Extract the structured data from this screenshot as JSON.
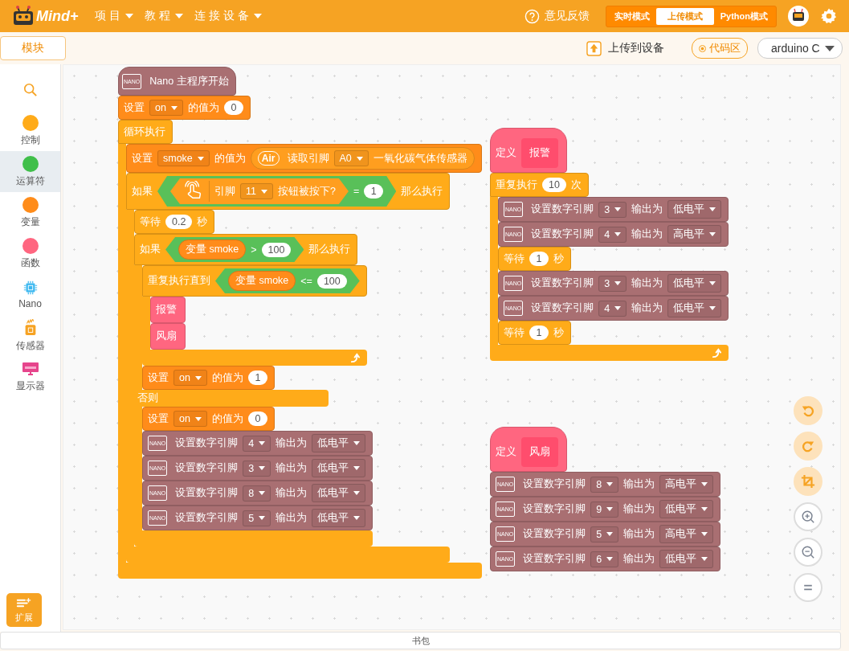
{
  "top_bar": {
    "logo": "Mind+",
    "menus": [
      {
        "label": "项目"
      },
      {
        "label": "教程"
      },
      {
        "label": "连接设备"
      }
    ],
    "feedback": "意见反馈",
    "modes": [
      {
        "label": "实时模式",
        "selected": false
      },
      {
        "label": "上传模式",
        "selected": true
      },
      {
        "label": "Python模式",
        "selected": false
      }
    ]
  },
  "toolbar": {
    "tab": "模块",
    "upload": "上传到设备",
    "code_area": "代码区",
    "device": "arduino C"
  },
  "sidebar": {
    "categories": [
      {
        "kind": "search",
        "selected": false
      },
      {
        "kind": "dot",
        "label": "控制",
        "color": "#ffab19",
        "selected": false
      },
      {
        "kind": "dot",
        "label": "运算符",
        "color": "#40bf4a",
        "selected": true
      },
      {
        "kind": "dot",
        "label": "变量",
        "color": "#ff8c1a",
        "selected": false
      },
      {
        "kind": "dot",
        "label": "函数",
        "color": "#ff6680",
        "selected": false
      },
      {
        "kind": "chip",
        "label": "Nano",
        "selected": false
      },
      {
        "kind": "sensor",
        "label": "传感器",
        "selected": false
      },
      {
        "kind": "display",
        "label": "显示器",
        "selected": false
      }
    ],
    "extension": "扩展"
  },
  "scripts": [
    {
      "blocks": [
        {
          "kind": "hat",
          "color": "#a96f72",
          "parts": [
            {
              "kind": "board",
              "text": "NANO"
            },
            {
              "kind": "text",
              "text": "Nano 主程序开始"
            }
          ]
        },
        {
          "kind": "stack",
          "color": "#ff8c1a",
          "parts": [
            {
              "kind": "text",
              "text": "设置"
            },
            {
              "kind": "dropdown",
              "text": "on"
            },
            {
              "kind": "text",
              "text": "的值为"
            },
            {
              "kind": "number",
              "text": "0"
            }
          ]
        },
        {
          "kind": "forever",
          "color": "#ffab19",
          "parts": [
            {
              "kind": "text",
              "text": "循环执行"
            }
          ],
          "body": [
            {
              "kind": "stack",
              "color": "#ff8c1a",
              "parts": [
                {
                  "kind": "text",
                  "text": "设置"
                },
                {
                  "kind": "dropdown",
                  "text": "smoke"
                },
                {
                  "kind": "text",
                  "text": "的值为"
                },
                {
                  "kind": "reporter",
                  "color": "#ff9e1f",
                  "parts": [
                    {
                      "kind": "cloud",
                      "text": "Air"
                    },
                    {
                      "kind": "text",
                      "text": "读取引脚"
                    },
                    {
                      "kind": "dropdown",
                      "text": "A0"
                    },
                    {
                      "kind": "text",
                      "text": "一氧化碳气体传感器"
                    }
                  ]
                }
              ]
            },
            {
              "kind": "if",
              "color": "#ffab19",
              "parts": [
                {
                  "kind": "text",
                  "text": "如果"
                },
                {
                  "kind": "boolean",
                  "color": "#59c059",
                  "parts": [
                    {
                      "kind": "button-boolean",
                      "color": "#ff9e1f",
                      "parts": [
                        {
                          "kind": "text",
                          "text": "引脚"
                        },
                        {
                          "kind": "dropdown",
                          "text": "11"
                        },
                        {
                          "kind": "text",
                          "text": "按钮被按下?"
                        }
                      ]
                    },
                    {
                      "kind": "text",
                      "text": "="
                    },
                    {
                      "kind": "number",
                      "text": "1"
                    }
                  ]
                },
                {
                  "kind": "text",
                  "text": "那么执行"
                }
              ],
              "body": [
                {
                  "kind": "stack",
                  "color": "#ffab19",
                  "parts": [
                    {
                      "kind": "text",
                      "text": "等待"
                    },
                    {
                      "kind": "number",
                      "text": "0.2"
                    },
                    {
                      "kind": "text",
                      "text": "秒"
                    }
                  ]
                },
                {
                  "kind": "if-else",
                  "color": "#ffab19",
                  "parts": [
                    {
                      "kind": "text",
                      "text": "如果"
                    },
                    {
                      "kind": "boolean",
                      "color": "#59c059",
                      "parts": [
                        {
                          "kind": "reporter",
                          "color": "#ff8c1a",
                          "parts": [
                            {
                              "kind": "text",
                              "text": "变量 smoke"
                            }
                          ]
                        },
                        {
                          "kind": "text",
                          "text": ">"
                        },
                        {
                          "kind": "number",
                          "text": "100"
                        }
                      ]
                    },
                    {
                      "kind": "text",
                      "text": "那么执行"
                    }
                  ],
                  "body": [
                    {
                      "kind": "repeat",
                      "color": "#ffab19",
                      "parts": [
                        {
                          "kind": "text",
                          "text": "重复执行直到"
                        },
                        {
                          "kind": "boolean",
                          "color": "#59c059",
                          "parts": [
                            {
                              "kind": "reporter",
                              "color": "#ff8c1a",
                              "parts": [
                                {
                                  "kind": "text",
                                  "text": "变量 smoke"
                                }
                              ]
                            },
                            {
                              "kind": "text",
                              "text": "<="
                            },
                            {
                              "kind": "number",
                              "text": "100"
                            }
                          ]
                        }
                      ],
                      "body": [
                        {
                          "kind": "call",
                          "color": "#ff6680",
                          "parts": [
                            {
                              "kind": "text",
                              "text": "报警"
                            }
                          ]
                        },
                        {
                          "kind": "call",
                          "color": "#ff6680",
                          "parts": [
                            {
                              "kind": "text",
                              "text": "风扇"
                            }
                          ]
                        }
                      ]
                    },
                    {
                      "kind": "stack",
                      "color": "#ff8c1a",
                      "parts": [
                        {
                          "kind": "text",
                          "text": "设置"
                        },
                        {
                          "kind": "dropdown",
                          "text": "on"
                        },
                        {
                          "kind": "text",
                          "text": "的值为"
                        },
                        {
                          "kind": "number",
                          "text": "1"
                        }
                      ]
                    }
                  ],
                  "else_label": "否则",
                  "else_body": [
                    {
                      "kind": "stack",
                      "color": "#ff8c1a",
                      "parts": [
                        {
                          "kind": "text",
                          "text": "设置"
                        },
                        {
                          "kind": "dropdown",
                          "text": "on"
                        },
                        {
                          "kind": "text",
                          "text": "的值为"
                        },
                        {
                          "kind": "number",
                          "text": "0"
                        }
                      ]
                    },
                    {
                      "kind": "stack",
                      "color": "#a96f72",
                      "parts": [
                        {
                          "kind": "board",
                          "text": "NANO"
                        },
                        {
                          "kind": "text",
                          "text": "设置数字引脚"
                        },
                        {
                          "kind": "dropdown",
                          "text": "4"
                        },
                        {
                          "kind": "text",
                          "text": "输出为"
                        },
                        {
                          "kind": "dropdown",
                          "text": "低电平"
                        }
                      ]
                    },
                    {
                      "kind": "stack",
                      "color": "#a96f72",
                      "parts": [
                        {
                          "kind": "board",
                          "text": "NANO"
                        },
                        {
                          "kind": "text",
                          "text": "设置数字引脚"
                        },
                        {
                          "kind": "dropdown",
                          "text": "3"
                        },
                        {
                          "kind": "text",
                          "text": "输出为"
                        },
                        {
                          "kind": "dropdown",
                          "text": "低电平"
                        }
                      ]
                    },
                    {
                      "kind": "stack",
                      "color": "#a96f72",
                      "parts": [
                        {
                          "kind": "board",
                          "text": "NANO"
                        },
                        {
                          "kind": "text",
                          "text": "设置数字引脚"
                        },
                        {
                          "kind": "dropdown",
                          "text": "8"
                        },
                        {
                          "kind": "text",
                          "text": "输出为"
                        },
                        {
                          "kind": "dropdown",
                          "text": "低电平"
                        }
                      ]
                    },
                    {
                      "kind": "stack",
                      "color": "#a96f72",
                      "parts": [
                        {
                          "kind": "board",
                          "text": "NANO"
                        },
                        {
                          "kind": "text",
                          "text": "设置数字引脚"
                        },
                        {
                          "kind": "dropdown",
                          "text": "5"
                        },
                        {
                          "kind": "text",
                          "text": "输出为"
                        },
                        {
                          "kind": "dropdown",
                          "text": "低电平"
                        }
                      ]
                    }
                  ]
                }
              ]
            }
          ]
        }
      ]
    },
    {
      "blocks": [
        {
          "kind": "define",
          "color": "#ff6680",
          "parts": [
            {
              "kind": "text",
              "text": "定义"
            },
            {
              "kind": "prototype",
              "text": "报警"
            }
          ]
        },
        {
          "kind": "repeat",
          "color": "#ffab19",
          "parts": [
            {
              "kind": "text",
              "text": "重复执行"
            },
            {
              "kind": "number",
              "text": "10"
            },
            {
              "kind": "text",
              "text": "次"
            }
          ],
          "body": [
            {
              "kind": "stack",
              "color": "#a96f72",
              "parts": [
                {
                  "kind": "board",
                  "text": "NANO"
                },
                {
                  "kind": "text",
                  "text": "设置数字引脚"
                },
                {
                  "kind": "dropdown",
                  "text": "3"
                },
                {
                  "kind": "text",
                  "text": "输出为"
                },
                {
                  "kind": "dropdown",
                  "text": "低电平"
                }
              ]
            },
            {
              "kind": "stack",
              "color": "#a96f72",
              "parts": [
                {
                  "kind": "board",
                  "text": "NANO"
                },
                {
                  "kind": "text",
                  "text": "设置数字引脚"
                },
                {
                  "kind": "dropdown",
                  "text": "4"
                },
                {
                  "kind": "text",
                  "text": "输出为"
                },
                {
                  "kind": "dropdown",
                  "text": "高电平"
                }
              ]
            },
            {
              "kind": "stack",
              "color": "#ffab19",
              "parts": [
                {
                  "kind": "text",
                  "text": "等待"
                },
                {
                  "kind": "number",
                  "text": "1"
                },
                {
                  "kind": "text",
                  "text": "秒"
                }
              ]
            },
            {
              "kind": "stack",
              "color": "#a96f72",
              "parts": [
                {
                  "kind": "board",
                  "text": "NANO"
                },
                {
                  "kind": "text",
                  "text": "设置数字引脚"
                },
                {
                  "kind": "dropdown",
                  "text": "3"
                },
                {
                  "kind": "text",
                  "text": "输出为"
                },
                {
                  "kind": "dropdown",
                  "text": "低电平"
                }
              ]
            },
            {
              "kind": "stack",
              "color": "#a96f72",
              "parts": [
                {
                  "kind": "board",
                  "text": "NANO"
                },
                {
                  "kind": "text",
                  "text": "设置数字引脚"
                },
                {
                  "kind": "dropdown",
                  "text": "4"
                },
                {
                  "kind": "text",
                  "text": "输出为"
                },
                {
                  "kind": "dropdown",
                  "text": "低电平"
                }
              ]
            },
            {
              "kind": "stack",
              "color": "#ffab19",
              "parts": [
                {
                  "kind": "text",
                  "text": "等待"
                },
                {
                  "kind": "number",
                  "text": "1"
                },
                {
                  "kind": "text",
                  "text": "秒"
                }
              ]
            }
          ]
        }
      ]
    },
    {
      "blocks": [
        {
          "kind": "define",
          "color": "#ff6680",
          "parts": [
            {
              "kind": "text",
              "text": "定义"
            },
            {
              "kind": "prototype",
              "text": "风扇"
            }
          ]
        },
        {
          "kind": "stack",
          "color": "#a96f72",
          "parts": [
            {
              "kind": "board",
              "text": "NANO"
            },
            {
              "kind": "text",
              "text": "设置数字引脚"
            },
            {
              "kind": "dropdown",
              "text": "8"
            },
            {
              "kind": "text",
              "text": "输出为"
            },
            {
              "kind": "dropdown",
              "text": "高电平"
            }
          ]
        },
        {
          "kind": "stack",
          "color": "#a96f72",
          "parts": [
            {
              "kind": "board",
              "text": "NANO"
            },
            {
              "kind": "text",
              "text": "设置数字引脚"
            },
            {
              "kind": "dropdown",
              "text": "9"
            },
            {
              "kind": "text",
              "text": "输出为"
            },
            {
              "kind": "dropdown",
              "text": "低电平"
            }
          ]
        },
        {
          "kind": "stack",
          "color": "#a96f72",
          "parts": [
            {
              "kind": "board",
              "text": "NANO"
            },
            {
              "kind": "text",
              "text": "设置数字引脚"
            },
            {
              "kind": "dropdown",
              "text": "5"
            },
            {
              "kind": "text",
              "text": "输出为"
            },
            {
              "kind": "dropdown",
              "text": "高电平"
            }
          ]
        },
        {
          "kind": "stack",
          "color": "#a96f72",
          "parts": [
            {
              "kind": "board",
              "text": "NANO"
            },
            {
              "kind": "text",
              "text": "设置数字引脚"
            },
            {
              "kind": "dropdown",
              "text": "6"
            },
            {
              "kind": "text",
              "text": "输出为"
            },
            {
              "kind": "dropdown",
              "text": "低电平"
            }
          ]
        }
      ]
    }
  ],
  "backpack": "书包"
}
